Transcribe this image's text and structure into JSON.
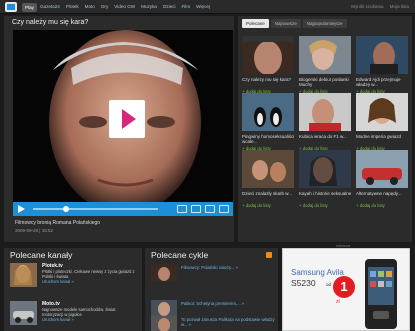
{
  "nav": {
    "items": [
      "Play",
      "Gazeta24",
      "Plotek",
      "Moto",
      "Gry",
      "Video GW",
      "Muzyka",
      "Dzieci",
      "Film",
      "Więcej"
    ],
    "right": [
      "Wyniki szukania",
      "Moja lista"
    ]
  },
  "video": {
    "title": "Czy należy mu się kara?",
    "caption": "Filmowcy bronią Romana Polańskiego",
    "date": "2009-09-28",
    "time": "15:52"
  },
  "related": {
    "tabs": [
      "Polecane",
      "Najnowsze",
      "Najpopularniejsze"
    ],
    "tiles": [
      {
        "title": "Czy należy mu się kara?",
        "add": "+ dodaj do listy"
      },
      {
        "title": "Blogerski debiut posłanki Muchy",
        "add": "+ dodaj do listy"
      },
      {
        "title": "Edward Ajdi przejmuje władzę w...",
        "add": "+ dodaj do listy"
      },
      {
        "title": "Pingwiny homoseksualiści wcale...",
        "add": "+ dodaj do listy"
      },
      {
        "title": "Kubica wraca do F1 w...",
        "add": "+ dodaj do listy"
      },
      {
        "title": "Modne imperia gwiazd",
        "add": "+ dodaj do listy"
      },
      {
        "title": "Dzieci znalazły skarb w...",
        "add": "+ dodaj do listy"
      },
      {
        "title": "Kayah i historie seksualne",
        "add": "+ dodaj do listy"
      },
      {
        "title": "Alternatywne napędy...",
        "add": "+ dodaj do listy"
      }
    ]
  },
  "ad_label": "reklama",
  "channels": {
    "title": "Polecane kanały",
    "items": [
      {
        "name": "Plotek.tv",
        "desc": "Plotki i ploteczki. Ciekawe newsy z życia gwiazd z Polski i świata",
        "link": "Uruchom kanał »"
      },
      {
        "name": "Moto.tv",
        "desc": "Najnowsze modele samochodów. Świat motoryzacji w pigułce",
        "link": "Uruchom kanał »"
      }
    ]
  },
  "cycles": {
    "title": "Polecane cykle",
    "items": [
      {
        "text": "Filmowcy: Polański należy... »"
      },
      {
        "text": "Palikot: Schetyna premierem,... »"
      },
      {
        "text": "To pozwał Janusza Palikota na podstawie władzy w... »"
      }
    ]
  },
  "ad": {
    "brand": "Samsung Avila",
    "model": "S5230",
    "od": "od",
    "price": "1",
    "currency": "zł"
  },
  "colors": {
    "accent": "#1c8fd6",
    "add_link": "#7bc043",
    "link": "#6bb7e6"
  }
}
